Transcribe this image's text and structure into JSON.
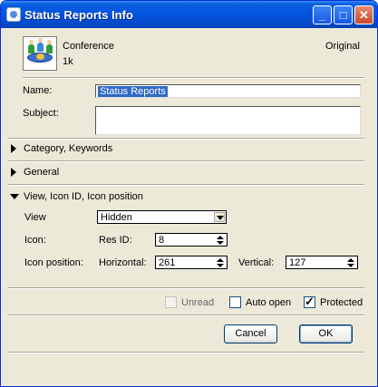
{
  "window": {
    "title": "Status Reports Info"
  },
  "header": {
    "type_label": "Conference",
    "size_label": "1k",
    "status_label": "Original"
  },
  "fields": {
    "name_label": "Name:",
    "name_value": "Status Reports",
    "subject_label": "Subject:",
    "subject_value": ""
  },
  "sections": {
    "category": "Category, Keywords",
    "general": "General",
    "view_icon": "View, Icon ID, Icon position"
  },
  "view_section": {
    "view_label": "View",
    "view_value": "Hidden",
    "icon_label": "Icon:",
    "res_id_label": "Res ID:",
    "res_id_value": "8",
    "icon_position_label": "Icon position:",
    "horizontal_label": "Horizontal:",
    "horizontal_value": "261",
    "vertical_label": "Vertical:",
    "vertical_value": "127"
  },
  "options": {
    "unread_label": "Unread",
    "unread_checked": false,
    "auto_open_label": "Auto open",
    "auto_open_checked": false,
    "protected_label": "Protected",
    "protected_checked": true
  },
  "buttons": {
    "cancel": "Cancel",
    "ok": "OK"
  },
  "colors": {
    "titlebar": "#0454de",
    "dialog_bg": "#ece9d8",
    "selection": "#316ac5"
  }
}
